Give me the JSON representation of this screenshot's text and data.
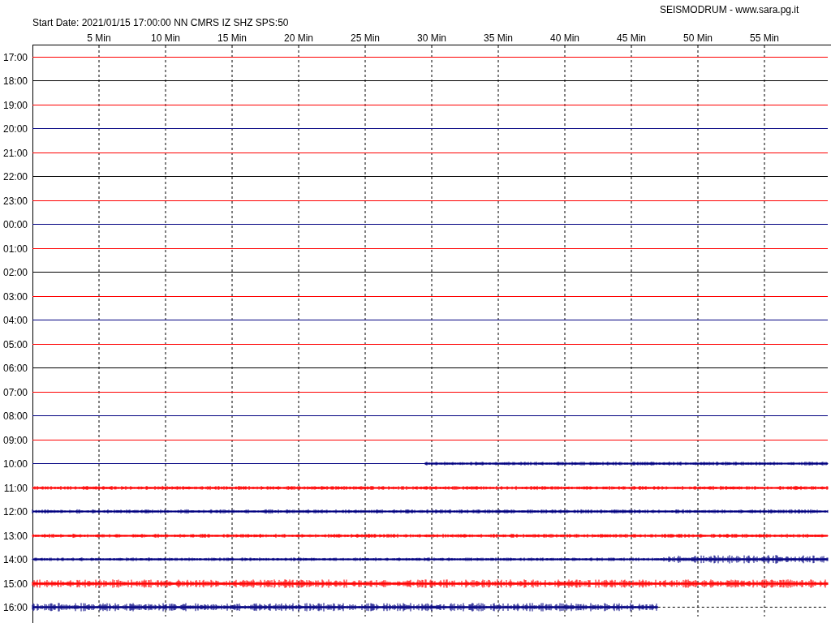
{
  "header": {
    "title": "SEISMODRUM - www.sara.pg.it",
    "start_info": "Start Date: 2021/01/15 17:00:00 NN CMRS IZ SHZ SPS:50"
  },
  "minute_labels": [
    "5 Min",
    "10 Min",
    "15 Min",
    "20 Min",
    "25 Min",
    "30 Min",
    "35 Min",
    "40 Min",
    "45 Min",
    "50 Min",
    "55 Min"
  ],
  "rows": [
    {
      "hour": "17:00",
      "color": "#ff0000",
      "kind": "line"
    },
    {
      "hour": "18:00",
      "color": "#000000",
      "kind": "line"
    },
    {
      "hour": "19:00",
      "color": "#ff0000",
      "kind": "line"
    },
    {
      "hour": "20:00",
      "color": "#000080",
      "kind": "line"
    },
    {
      "hour": "21:00",
      "color": "#ff0000",
      "kind": "line"
    },
    {
      "hour": "22:00",
      "color": "#000000",
      "kind": "line"
    },
    {
      "hour": "23:00",
      "color": "#ff0000",
      "kind": "line"
    },
    {
      "hour": "00:00",
      "color": "#000080",
      "kind": "line"
    },
    {
      "hour": "01:00",
      "color": "#ff0000",
      "kind": "line"
    },
    {
      "hour": "02:00",
      "color": "#000000",
      "kind": "line"
    },
    {
      "hour": "03:00",
      "color": "#ff0000",
      "kind": "line"
    },
    {
      "hour": "04:00",
      "color": "#000080",
      "kind": "line"
    },
    {
      "hour": "05:00",
      "color": "#ff0000",
      "kind": "line"
    },
    {
      "hour": "06:00",
      "color": "#000000",
      "kind": "line"
    },
    {
      "hour": "07:00",
      "color": "#ff0000",
      "kind": "line"
    },
    {
      "hour": "08:00",
      "color": "#000080",
      "kind": "line"
    },
    {
      "hour": "09:00",
      "color": "#ff0000",
      "kind": "line"
    },
    {
      "hour": "10:00",
      "color": "#000080",
      "kind": "late-start"
    },
    {
      "hour": "11:00",
      "color": "#ff0000",
      "kind": "trace"
    },
    {
      "hour": "12:00",
      "color": "#000080",
      "kind": "trace"
    },
    {
      "hour": "13:00",
      "color": "#ff0000",
      "kind": "trace"
    },
    {
      "hour": "14:00",
      "color": "#000080",
      "kind": "trace-rising"
    },
    {
      "hour": "15:00",
      "color": "#ff0000",
      "kind": "trace-strong"
    },
    {
      "hour": "16:00",
      "color": "#000080",
      "kind": "early-end"
    }
  ]
}
